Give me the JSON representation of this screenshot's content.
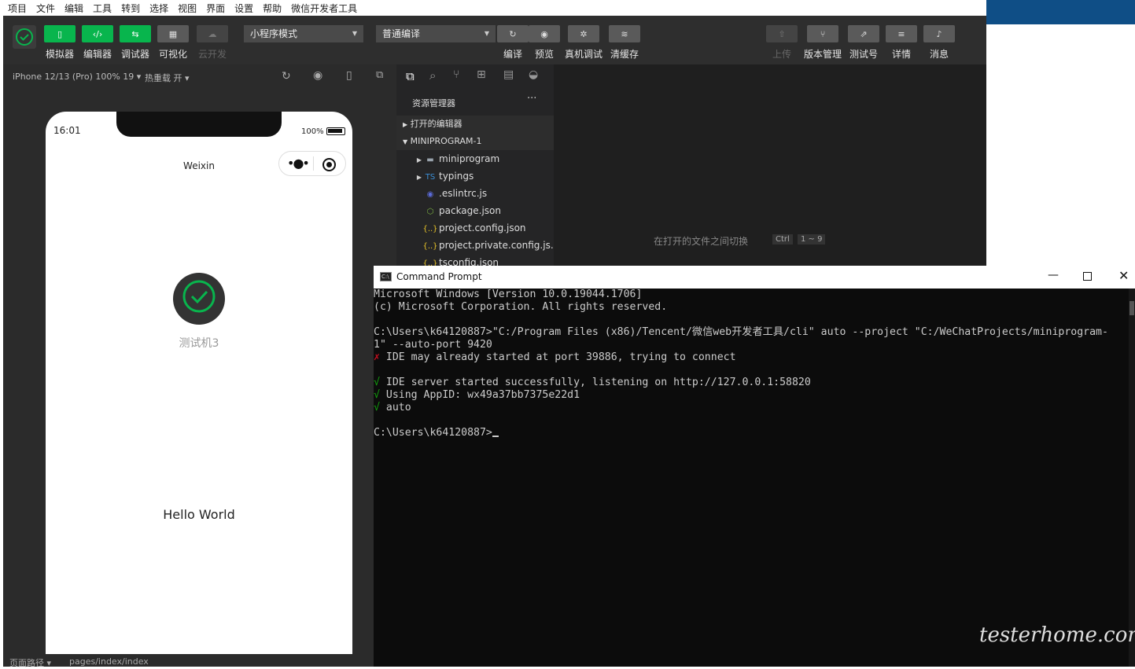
{
  "menu": [
    "项目",
    "文件",
    "编辑",
    "工具",
    "转到",
    "选择",
    "视图",
    "界面",
    "设置",
    "帮助",
    "微信开发者工具"
  ],
  "toolbar": {
    "left_buttons": [
      "模拟器",
      "编辑器",
      "调试器",
      "可视化",
      "云开发"
    ],
    "mode_select": "小程序模式",
    "compile_select": "普通编译",
    "mid_buttons": [
      "编译",
      "预览",
      "真机调试",
      "清缓存"
    ],
    "right_buttons": [
      "上传",
      "版本管理",
      "测试号",
      "详情",
      "消息"
    ]
  },
  "simbar": {
    "device": "iPhone 12/13 (Pro) 100% 19 ▾",
    "hotreload": "热重载 开 ▾"
  },
  "phone": {
    "time": "16:01",
    "battery": "100%",
    "nav_title": "Weixin",
    "avatar_caption": "测试机3",
    "hello": "Hello World"
  },
  "explorer": {
    "title": "资源管理器",
    "open_editors": "打开的编辑器",
    "project": "MINIPROGRAM-1",
    "files": [
      "miniprogram",
      "typings",
      ".eslintrc.js",
      "package.json",
      "project.config.json",
      "project.private.config.js...",
      "tsconfig.json"
    ]
  },
  "editor": {
    "hint": "在打开的文件之间切换",
    "key1": "Ctrl",
    "key2": "1 ~ 9"
  },
  "status": {
    "path_label": "页面路径 ▾",
    "path": "pages/index/index"
  },
  "cmd": {
    "title": "Command Prompt",
    "lines": [
      {
        "text": "Microsoft Windows [Version 10.0.19044.1706]"
      },
      {
        "text": "(c) Microsoft Corporation. All rights reserved."
      },
      {
        "text": ""
      },
      {
        "text": "C:\\Users\\k64120887>\"C:/Program Files (x86)/Tencent/微信web开发者工具/cli\" auto --project \"C:/WeChatProjects/miniprogram-"
      },
      {
        "text": "1\" --auto-port 9420"
      },
      {
        "mark": "✗",
        "text": " IDE may already started at port 39886, trying to connect"
      },
      {
        "text": ""
      },
      {
        "mark": "√",
        "text": " IDE server started successfully, listening on http://127.0.0.1:58820"
      },
      {
        "mark": "√",
        "text": " Using AppID: wx49a37bb7375e22d1"
      },
      {
        "mark": "√",
        "text": " auto"
      },
      {
        "text": ""
      },
      {
        "text": "C:\\Users\\k64120887>"
      }
    ]
  },
  "watermark": "testerhome.com",
  "colors": {
    "accent_green": "#08b54d",
    "cmd_bg": "#0c0c0c",
    "error_red": "#c50f1f",
    "ok_green": "#13a10e"
  }
}
